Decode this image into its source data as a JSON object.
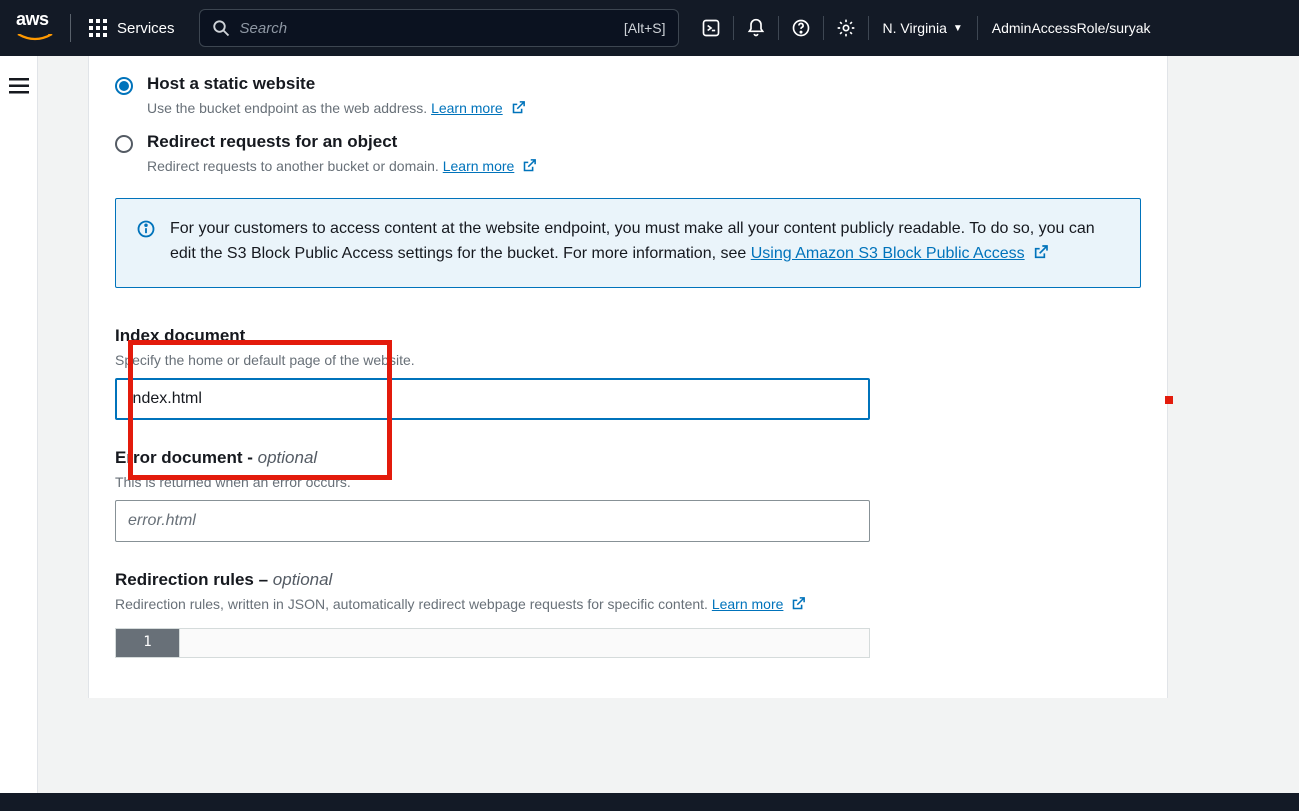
{
  "header": {
    "logo_text": "aws",
    "services_label": "Services",
    "search_placeholder": "Search",
    "search_shortcut": "[Alt+S]",
    "region": "N. Virginia",
    "account": "AdminAccessRole/suryak"
  },
  "hosting": {
    "opt_host": {
      "label": "Host a static website",
      "sub": "Use the bucket endpoint as the web address.",
      "learn_more": "Learn more"
    },
    "opt_redirect": {
      "label": "Redirect requests for an object",
      "sub": "Redirect requests to another bucket or domain.",
      "learn_more": "Learn more"
    }
  },
  "callout": {
    "text_a": "For your customers to access content at the website endpoint, you must make all your content publicly readable. To do so, you can edit the S3 Block Public Access settings for the bucket. For more information, see ",
    "link": "Using Amazon S3 Block Public Access"
  },
  "fields": {
    "index": {
      "label": "Index document",
      "help": "Specify the home or default page of the website.",
      "value": "index.html"
    },
    "error": {
      "label_a": "Error document",
      "label_b": " - ",
      "label_opt": "optional",
      "help": "This is returned when an error occurs.",
      "placeholder": "error.html"
    },
    "rules": {
      "label_a": "Redirection rules",
      "label_b": " – ",
      "label_opt": "optional",
      "help": "Redirection rules, written in JSON, automatically redirect webpage requests for specific content.",
      "learn_more": "Learn more"
    },
    "editor": {
      "line_number": "1"
    }
  }
}
